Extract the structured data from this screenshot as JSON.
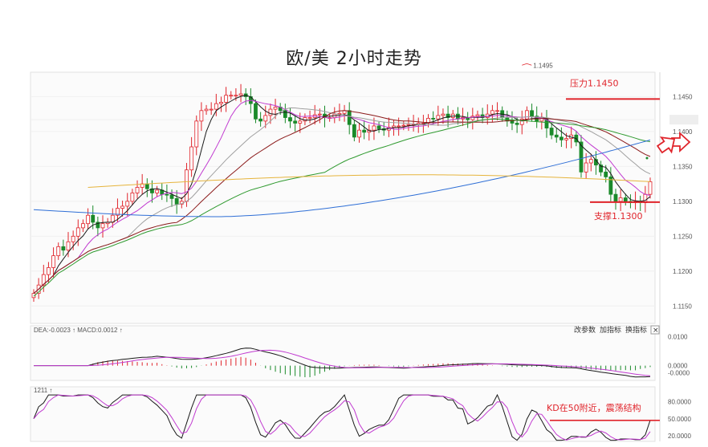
{
  "chart_data": {
    "type": "candlestick",
    "title": "欧/美 2小时走势",
    "main_panel": {
      "y_ticks": [
        "1.1450",
        "1.1417",
        "1.1400",
        "1.1350",
        "1.1300",
        "1.1250",
        "1.1200",
        "1.1150"
      ],
      "y_tick_values": [
        1.145,
        1.1417,
        1.14,
        1.135,
        1.13,
        1.125,
        1.12,
        1.115
      ],
      "ylim": [
        1.1125,
        1.1485
      ],
      "current_price": 1.1417,
      "high_marker": {
        "label": "1.1495",
        "value": 1.1495
      },
      "resistance": {
        "label": "压力1.1450",
        "value": 1.145
      },
      "support": {
        "label": "支撑1.1300",
        "value": 1.13
      },
      "candles_close": [
        1.1168,
        1.118,
        1.1195,
        1.1205,
        1.1222,
        1.1235,
        1.123,
        1.1242,
        1.125,
        1.1262,
        1.1268,
        1.128,
        1.127,
        1.1262,
        1.1268,
        1.127,
        1.128,
        1.129,
        1.1293,
        1.13,
        1.1312,
        1.132,
        1.1325,
        1.1318,
        1.1312,
        1.1316,
        1.131,
        1.1309,
        1.1304,
        1.1296,
        1.13,
        1.1345,
        1.1378,
        1.1415,
        1.143,
        1.1432,
        1.1432,
        1.144,
        1.1442,
        1.1452,
        1.1452,
        1.1452,
        1.1454,
        1.145,
        1.144,
        1.1418,
        1.1415,
        1.1423,
        1.1432,
        1.1435,
        1.143,
        1.142,
        1.1415,
        1.1412,
        1.1415,
        1.142,
        1.142,
        1.1424,
        1.1425,
        1.142,
        1.142,
        1.1425,
        1.1426,
        1.143,
        1.141,
        1.1392,
        1.1402,
        1.1399,
        1.1402,
        1.1408,
        1.1404,
        1.1402,
        1.1406,
        1.1408,
        1.1408,
        1.1409,
        1.141,
        1.141,
        1.1412,
        1.1412,
        1.1419,
        1.1418,
        1.1423,
        1.1425,
        1.142,
        1.1425,
        1.1418,
        1.142,
        1.1417,
        1.1422,
        1.1424,
        1.142,
        1.1425,
        1.143,
        1.143,
        1.142,
        1.1415,
        1.1412,
        1.141,
        1.1418,
        1.143,
        1.1422,
        1.1415,
        1.1419,
        1.1405,
        1.1395,
        1.1392,
        1.1388,
        1.139,
        1.1395,
        1.1385,
        1.1342,
        1.1355,
        1.136,
        1.1352,
        1.1342,
        1.1335,
        1.131,
        1.13,
        1.1305,
        1.13,
        1.1298,
        1.13,
        1.1298,
        1.131,
        1.1328
      ]
    },
    "macd_panel": {
      "header": "DEA:-0.0023  ↑ MACD:0.0012 ↑",
      "dea_label": "DEA:-0.0023",
      "macd_label": "MACD:0.0012",
      "y_ticks": [
        "0.0100",
        "0.0000",
        "-0.0000"
      ],
      "y_tick_values": [
        0.01,
        0.0,
        -0.0025
      ],
      "ylim": [
        -0.0045,
        0.012
      ]
    },
    "kd_panel": {
      "header": "1211 ↑",
      "y_ticks": [
        "80.0000",
        "50.0000",
        "20.0000"
      ],
      "y_tick_values": [
        80,
        50,
        20
      ],
      "ylim": [
        10,
        95
      ],
      "annotation": "KD在50附近，震荡结构"
    },
    "buttons": [
      "改参数",
      "加指标",
      "换指标"
    ],
    "colors": {
      "up": "#e0242b",
      "down": "#1a8a2a",
      "resistance": "#e0242b",
      "support": "#e0242b",
      "grid": "#f0f0f0"
    }
  }
}
